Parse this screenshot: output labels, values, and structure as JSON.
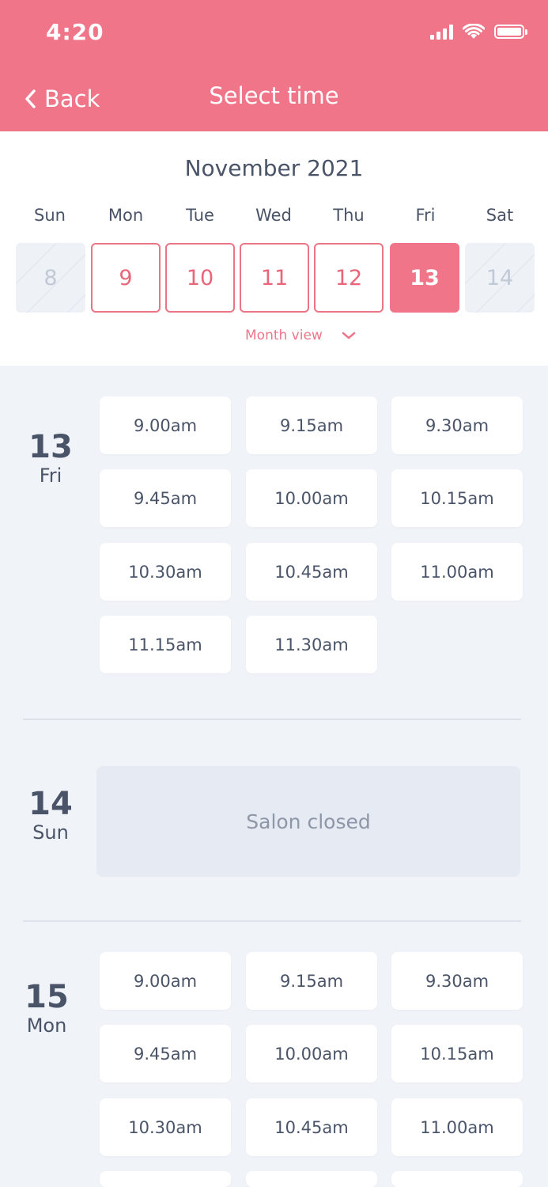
{
  "status_bar": {
    "time": "4:20"
  },
  "nav": {
    "back_label": "Back",
    "title": "Select time"
  },
  "calendar": {
    "month": "November 2021",
    "weekdays": [
      "Sun",
      "Mon",
      "Tue",
      "Wed",
      "Thu",
      "Fri",
      "Sat"
    ],
    "days": [
      {
        "num": "8",
        "state": "disabled"
      },
      {
        "num": "9",
        "state": "available"
      },
      {
        "num": "10",
        "state": "available"
      },
      {
        "num": "11",
        "state": "available"
      },
      {
        "num": "12",
        "state": "available"
      },
      {
        "num": "13",
        "state": "selected"
      },
      {
        "num": "14",
        "state": "disabled"
      }
    ],
    "month_view_label": "Month view"
  },
  "schedule": [
    {
      "day_num": "13",
      "weekday": "Fri",
      "slots": [
        "9.00am",
        "9.15am",
        "9.30am",
        "9.45am",
        "10.00am",
        "10.15am",
        "10.30am",
        "10.45am",
        "11.00am",
        "11.15am",
        "11.30am"
      ]
    },
    {
      "day_num": "14",
      "weekday": "Sun",
      "closed_text": "Salon closed"
    },
    {
      "day_num": "15",
      "weekday": "Mon",
      "slots": [
        "9.00am",
        "9.15am",
        "9.30am",
        "9.45am",
        "10.00am",
        "10.15am",
        "10.30am",
        "10.45am",
        "11.00am"
      ]
    }
  ]
}
